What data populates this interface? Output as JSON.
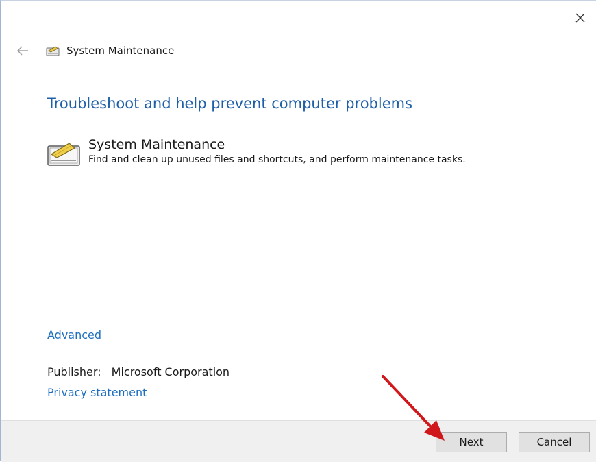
{
  "window": {
    "title": "System Maintenance"
  },
  "main": {
    "heading": "Troubleshoot and help prevent computer problems",
    "item": {
      "title": "System Maintenance",
      "description": "Find and clean up unused files and shortcuts, and perform maintenance tasks."
    },
    "advanced_link": "Advanced",
    "publisher_label": "Publisher:",
    "publisher_value": "Microsoft Corporation",
    "privacy_link": "Privacy statement"
  },
  "footer": {
    "next_label": "Next",
    "cancel_label": "Cancel"
  },
  "icons": {
    "close": "close-icon",
    "back": "back-arrow-icon",
    "maintenance": "system-maintenance-icon",
    "annotation": "red-arrow-annotation"
  },
  "colors": {
    "heading": "#1f5fa8",
    "link": "#1f6fbf",
    "footer_bg": "#f0f0f0",
    "annotation_arrow": "#d0181c"
  }
}
